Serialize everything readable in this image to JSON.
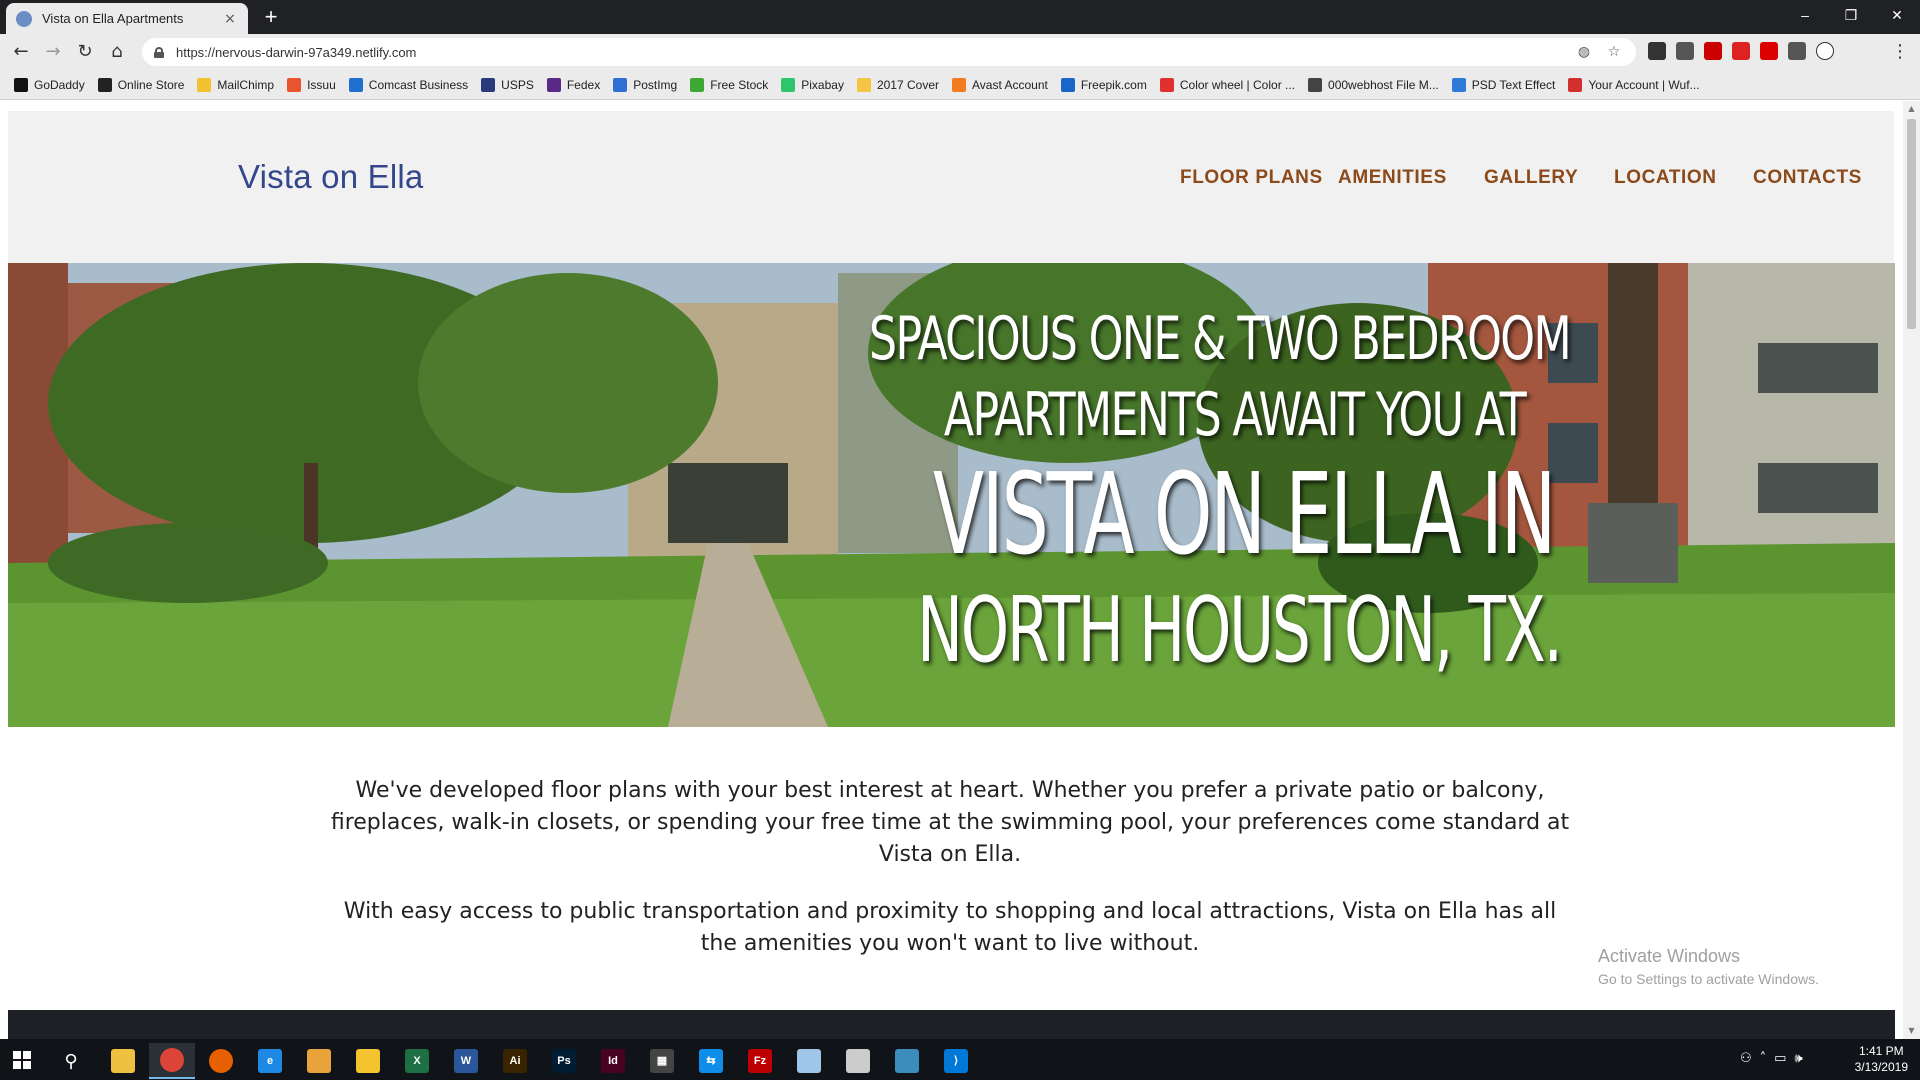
{
  "browser": {
    "tab_title": "Vista on Ella Apartments",
    "tab_close": "×",
    "new_tab": "+",
    "window_controls": [
      "–",
      "❐",
      "✕"
    ],
    "url": "https://nervous-darwin-97a349.netlify.com",
    "bookmarks": [
      {
        "label": "GoDaddy",
        "color": "#111111"
      },
      {
        "label": "Online Store",
        "color": "#222222"
      },
      {
        "label": "MailChimp",
        "color": "#f2c230"
      },
      {
        "label": "Issuu",
        "color": "#e8542d"
      },
      {
        "label": "Comcast Business",
        "color": "#1f6fd1"
      },
      {
        "label": "USPS",
        "color": "#2b3a7a"
      },
      {
        "label": "Fedex",
        "color": "#5b2a86"
      },
      {
        "label": "PostImg",
        "color": "#2f6fd4"
      },
      {
        "label": "Free Stock",
        "color": "#3da833"
      },
      {
        "label": "Pixabay",
        "color": "#2ec66d"
      },
      {
        "label": "2017 Cover",
        "color": "#f4c542"
      },
      {
        "label": "Avast Account",
        "color": "#f47a20"
      },
      {
        "label": "Freepik.com",
        "color": "#1b64c9"
      },
      {
        "label": "Color wheel | Color ...",
        "color": "#e03030"
      },
      {
        "label": "000webhost File M...",
        "color": "#444444"
      },
      {
        "label": "PSD Text Effect",
        "color": "#2f7ad9"
      },
      {
        "label": "Your Account | Wuf...",
        "color": "#d23030"
      }
    ]
  },
  "site": {
    "brand": "Vista on Ella",
    "nav": [
      "FLOOR PLANS",
      "AMENITIES",
      "GALLERY",
      "LOCATION",
      "CONTACTS"
    ],
    "hero": {
      "line1": "SPACIOUS ONE & TWO BEDROOM",
      "line2": "APARTMENTS AWAIT YOU AT",
      "line3": "VISTA ON ELLA IN",
      "line4": "NORTH HOUSTON, TX."
    },
    "intro": [
      "We've developed floor plans with your best interest at heart. Whether you prefer a private patio or balcony, fireplaces, walk-in closets, or spending your free time at the swimming pool, your preferences come standard at Vista on Ella.",
      "With easy access to public transportation and proximity to shopping and local attractions, Vista on Ella has all the amenities you won't want to live without."
    ],
    "colors": {
      "brand": "#34468c",
      "nav": "#8b4a1a",
      "header_bg": "#f1f1f1",
      "footer_bg": "#1d2126"
    }
  },
  "watermark": {
    "title": "Activate Windows",
    "subtitle": "Go to Settings to activate Windows."
  },
  "taskbar": {
    "apps": [
      {
        "name": "file-explorer-icon",
        "label": "",
        "color": "#f0c040"
      },
      {
        "name": "chrome-icon",
        "label": "",
        "color": "#db4437"
      },
      {
        "name": "firefox-icon",
        "label": "",
        "color": "#e66000"
      },
      {
        "name": "internet-explorer-icon",
        "label": "e",
        "color": "#1e88e5"
      },
      {
        "name": "app-icon",
        "label": "",
        "color": "#e8a33a"
      },
      {
        "name": "mail-icon",
        "label": "",
        "color": "#f4c430"
      },
      {
        "name": "excel-icon",
        "label": "X",
        "color": "#1d7044"
      },
      {
        "name": "word-icon",
        "label": "W",
        "color": "#2b579a"
      },
      {
        "name": "illustrator-icon",
        "label": "Ai",
        "color": "#3a2400"
      },
      {
        "name": "photoshop-icon",
        "label": "Ps",
        "color": "#001d34"
      },
      {
        "name": "indesign-icon",
        "label": "Id",
        "color": "#49021f"
      },
      {
        "name": "calculator-icon",
        "label": "▦",
        "color": "#444444"
      },
      {
        "name": "teamviewer-icon",
        "label": "⇆",
        "color": "#0e8ee9"
      },
      {
        "name": "filezilla-icon",
        "label": "Fz",
        "color": "#bf0000"
      },
      {
        "name": "notes-icon",
        "label": "",
        "color": "#9fc5e8"
      },
      {
        "name": "app2-icon",
        "label": "",
        "color": "#cccccc"
      },
      {
        "name": "app3-icon",
        "label": "",
        "color": "#3c8dbc"
      },
      {
        "name": "vscode-icon",
        "label": "⟩",
        "color": "#0078d7"
      }
    ],
    "time": "1:41 PM",
    "date": "3/13/2019"
  }
}
